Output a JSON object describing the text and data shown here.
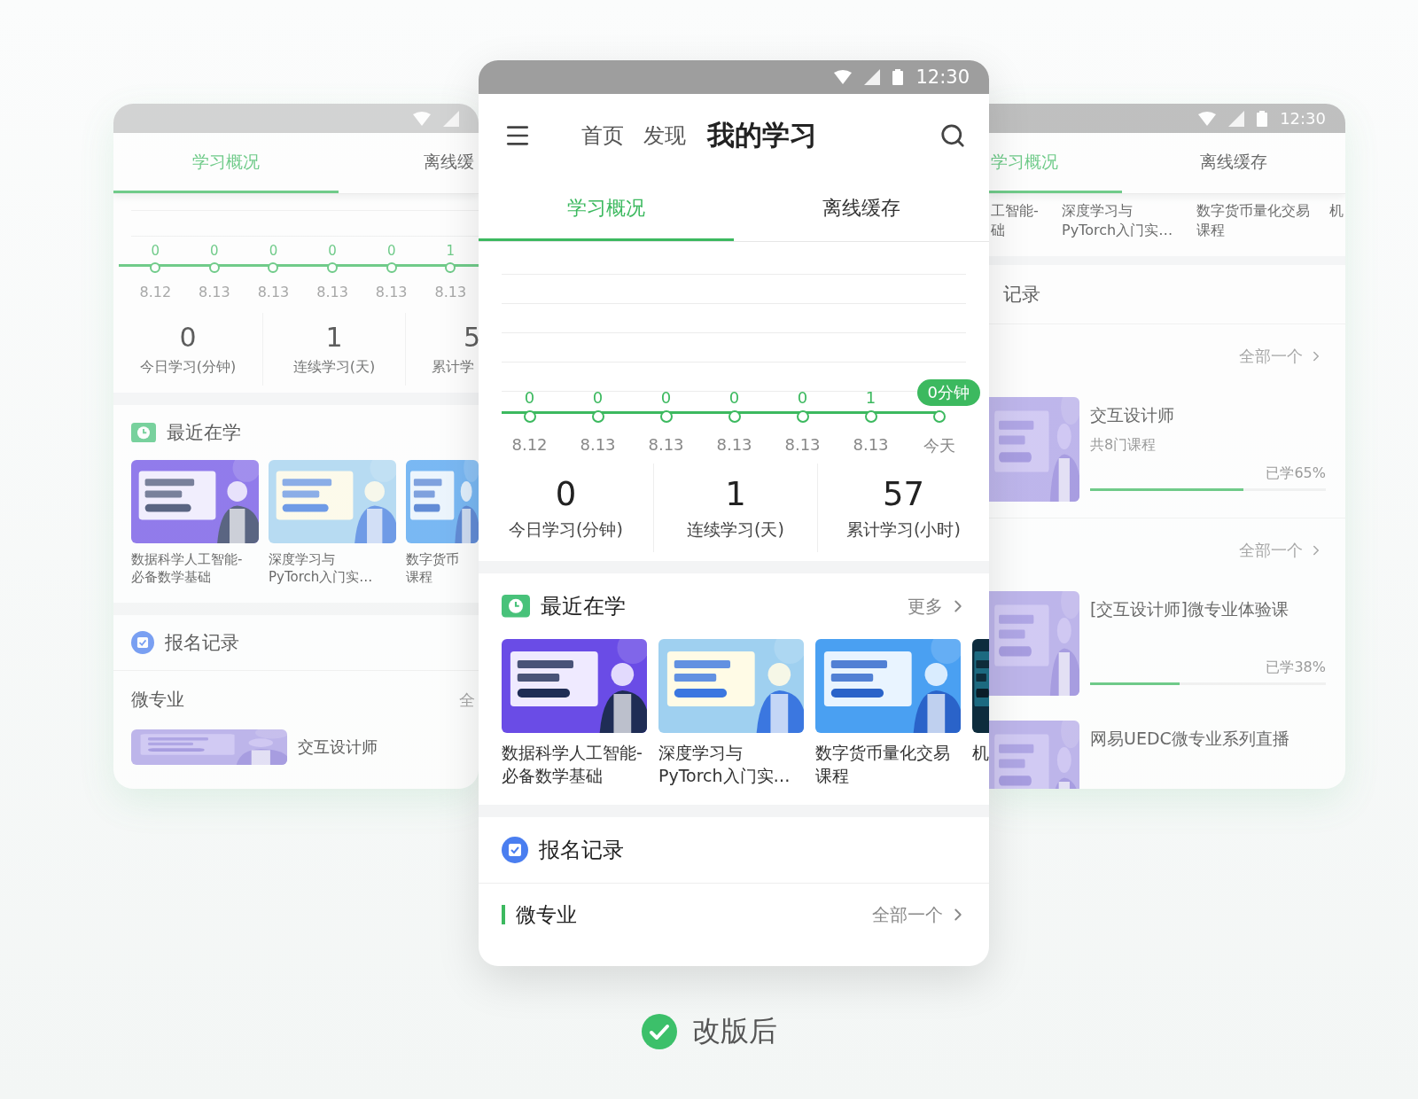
{
  "left_phone": {
    "tabs": [
      {
        "label": "学习概况",
        "selected": true
      },
      {
        "label": "离线缓",
        "selected": false
      }
    ],
    "points": [
      {
        "kind": "value",
        "label": "0",
        "date": "8.12"
      },
      {
        "kind": "value",
        "label": "0",
        "date": "8.13"
      },
      {
        "kind": "value",
        "label": "0",
        "date": "8.13"
      },
      {
        "kind": "value",
        "label": "0",
        "date": "8.13"
      },
      {
        "kind": "value",
        "label": "0",
        "date": "8.13"
      },
      {
        "kind": "value",
        "label": "1",
        "date": "8.13"
      }
    ],
    "stats": [
      {
        "value": "0",
        "label": "今日学习(分钟)"
      },
      {
        "value": "1",
        "label": "连续学习(天)"
      },
      {
        "value": "5",
        "label": "累计学"
      }
    ],
    "recent": {
      "title": "最近在学",
      "courses": [
        {
          "lines": [
            "数据科学人工智能-",
            "必备数学基础"
          ]
        },
        {
          "lines": [
            "深度学习与",
            "PyTorch入门实…"
          ]
        },
        {
          "lines": [
            "数字货币",
            "课程"
          ]
        }
      ]
    },
    "enrollment": {
      "title": "报名记录"
    },
    "micro": {
      "title": "微专业",
      "all": "全"
    },
    "course": {
      "title": "交互设计师"
    }
  },
  "main_phone": {
    "status_time": "12:30",
    "nav": [
      {
        "label": "首页",
        "selected": false
      },
      {
        "label": "发现",
        "selected": false
      },
      {
        "label": "我的学习",
        "selected": true
      }
    ],
    "tabs": [
      {
        "label": "学习概况",
        "selected": true
      },
      {
        "label": "离线缓存",
        "selected": false
      }
    ],
    "points": [
      {
        "kind": "value",
        "label": "0",
        "date": "8.12"
      },
      {
        "kind": "value",
        "label": "0",
        "date": "8.13"
      },
      {
        "kind": "value",
        "label": "0",
        "date": "8.13"
      },
      {
        "kind": "value",
        "label": "0",
        "date": "8.13"
      },
      {
        "kind": "value",
        "label": "0",
        "date": "8.13"
      },
      {
        "kind": "value",
        "label": "1",
        "date": "8.13"
      },
      {
        "kind": "badge",
        "label": "0分钟",
        "date": "今天"
      }
    ],
    "stats": [
      {
        "value": "0",
        "label": "今日学习(分钟)"
      },
      {
        "value": "1",
        "label": "连续学习(天)"
      },
      {
        "value": "57",
        "label": "累计学习(小时)"
      }
    ],
    "recent": {
      "title": "最近在学",
      "more": "更多",
      "courses": [
        {
          "lines": [
            "数据科学人工智能-",
            "必备数学基础"
          ]
        },
        {
          "lines": [
            "深度学习与",
            "PyTorch入门实…"
          ]
        },
        {
          "lines": [
            "数字货币量化交易",
            "课程"
          ]
        },
        {
          "lines": [
            "机"
          ]
        }
      ]
    },
    "enrollment": {
      "title": "报名记录"
    },
    "micro": {
      "title": "微专业",
      "all": "全部一个"
    }
  },
  "right_phone": {
    "status_time": "12:30",
    "tabs": [
      {
        "label": "学习概况",
        "selected": true
      },
      {
        "label": "离线缓存",
        "selected": false
      }
    ],
    "captions": [
      {
        "lines": [
          "工智能-",
          "础"
        ]
      },
      {
        "lines": [
          "深度学习与",
          "PyTorch入门实…"
        ]
      },
      {
        "lines": [
          "数字货币量化交易",
          "课程"
        ]
      },
      {
        "lines": [
          "机"
        ]
      }
    ],
    "section": "记录",
    "entries": [
      {
        "kind": "all-link",
        "label": "全部一个"
      },
      {
        "kind": "course",
        "title": "交互设计师",
        "subtitle": "共8门课程",
        "progress": "已学65%",
        "level": 0.65
      },
      {
        "kind": "all-link",
        "label": "全部一个"
      },
      {
        "kind": "course",
        "title": "[交互设计师]微专业体验课",
        "progress": "已学38%",
        "level": 0.38
      },
      {
        "kind": "course",
        "title": "网易UEDC微专业系列直播"
      }
    ]
  },
  "caption": "改版后"
}
